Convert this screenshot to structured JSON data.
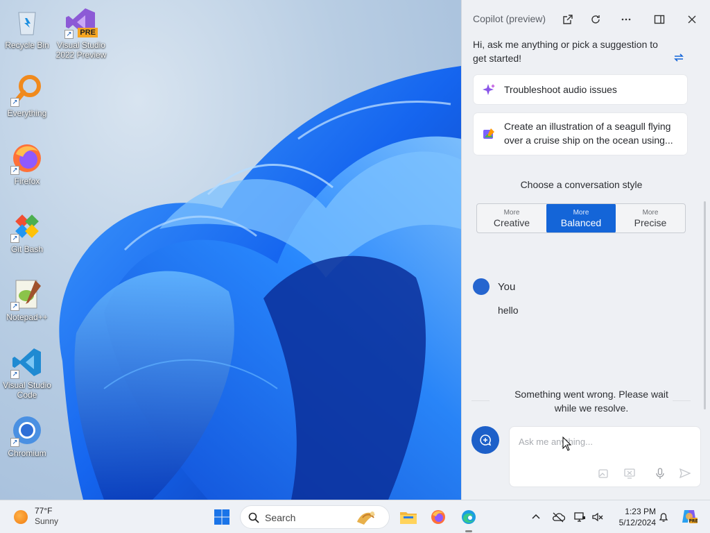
{
  "desktop": {
    "icons": [
      {
        "label": "Recycle Bin",
        "icon": "recycle-bin-icon"
      },
      {
        "label": "Visual Studio 2022 Preview",
        "icon": "visual-studio-icon",
        "badge": "PRE"
      },
      {
        "label": "Everything",
        "icon": "everything-search-icon"
      },
      {
        "label": "Firefox",
        "icon": "firefox-icon"
      },
      {
        "label": "Git Bash",
        "icon": "git-bash-icon"
      },
      {
        "label": "Notepad++",
        "icon": "notepad-plus-plus-icon"
      },
      {
        "label": "Visual Studio Code",
        "icon": "vscode-icon"
      },
      {
        "label": "Chromium",
        "icon": "chromium-icon"
      }
    ]
  },
  "copilot": {
    "title": "Copilot (preview)",
    "greeting": "Hi, ask me anything or pick a suggestion to get started!",
    "suggestions": [
      {
        "text": "Troubleshoot audio issues",
        "icon": "sparkle-icon"
      },
      {
        "text": "Create an illustration of a seagull flying over a cruise ship on the ocean using...",
        "icon": "image-create-icon"
      }
    ],
    "style_title": "Choose a conversation style",
    "styles": [
      {
        "small": "More",
        "label": "Creative",
        "active": false
      },
      {
        "small": "More",
        "label": "Balanced",
        "active": true
      },
      {
        "small": "More",
        "label": "Precise",
        "active": false
      }
    ],
    "user_name": "You",
    "user_message": "hello",
    "error_text": "Something went wrong. Please wait while we resolve.",
    "input_placeholder": "Ask me anything..."
  },
  "taskbar": {
    "temperature": "77°F",
    "condition": "Sunny",
    "search_label": "Search",
    "time": "1:23 PM",
    "date": "5/12/2024"
  },
  "colors": {
    "accent": "#1465d8",
    "panel_bg": "#eef0f4",
    "taskbar_bg": "#eef1f6"
  }
}
